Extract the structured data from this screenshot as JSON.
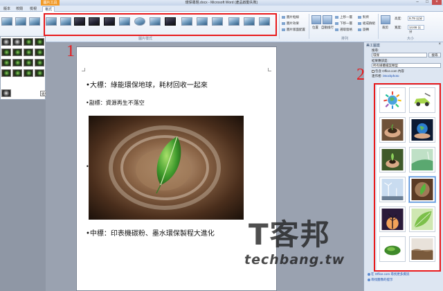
{
  "window": {
    "title": "環保專題.docx - Microsoft Word (產品啟動失敗)",
    "context_tab_group": "圖片工具",
    "controls": {
      "minimize": "–",
      "maximize": "□",
      "close": "×"
    }
  },
  "ribbon_tabs": [
    "版本",
    "校閱",
    "檢視",
    "格式"
  ],
  "ribbon": {
    "gallery_group_label": "圖片樣式",
    "picture_border": "圖片框線",
    "picture_effects": "圖片效果",
    "picture_layout": "圖片版面配置",
    "position": "位置",
    "wrap_text": "自動換行",
    "bring_forward": "上移一層",
    "send_backward": "下移一層",
    "selection_pane": "選取窗格",
    "align": "對齊",
    "group": "組成群組",
    "rotate": "旋轉",
    "arrange_group_label": "排列",
    "crop": "裁剪",
    "height_label": "高度:",
    "height_value": "9.79 公分",
    "width_label": "寬度:",
    "width_value": "14.66 公分",
    "size_group_label": "大小"
  },
  "left_panel": {
    "tooltip": "組版樣式"
  },
  "document": {
    "heading": "•大標：綠能環保地球，耗材回收一起來",
    "subheading": "•副標：資源再生不落空",
    "bullet": "•",
    "midheading": "•中標：印表機碳粉、墨水環保製程大進化"
  },
  "annotations": {
    "box1_number": "1",
    "box2_number": "2"
  },
  "watermark": {
    "logo": "T客邦",
    "site": "techbang.tw"
  },
  "clip_pane": {
    "title": "美工圖案",
    "search_label": "搜尋:",
    "search_value": "環保",
    "go_button": "搜尋",
    "results_label": "結果應該是:",
    "results_value": "所有媒體檔案類型",
    "include_office": "包含 Office.com 內容",
    "license_prefix": "連作者:",
    "license_link": "iStockphoto",
    "footer_more": "在 Office.com 尋找更多資訊",
    "footer_hints": "尋找圖像的提示",
    "close": "×"
  }
}
